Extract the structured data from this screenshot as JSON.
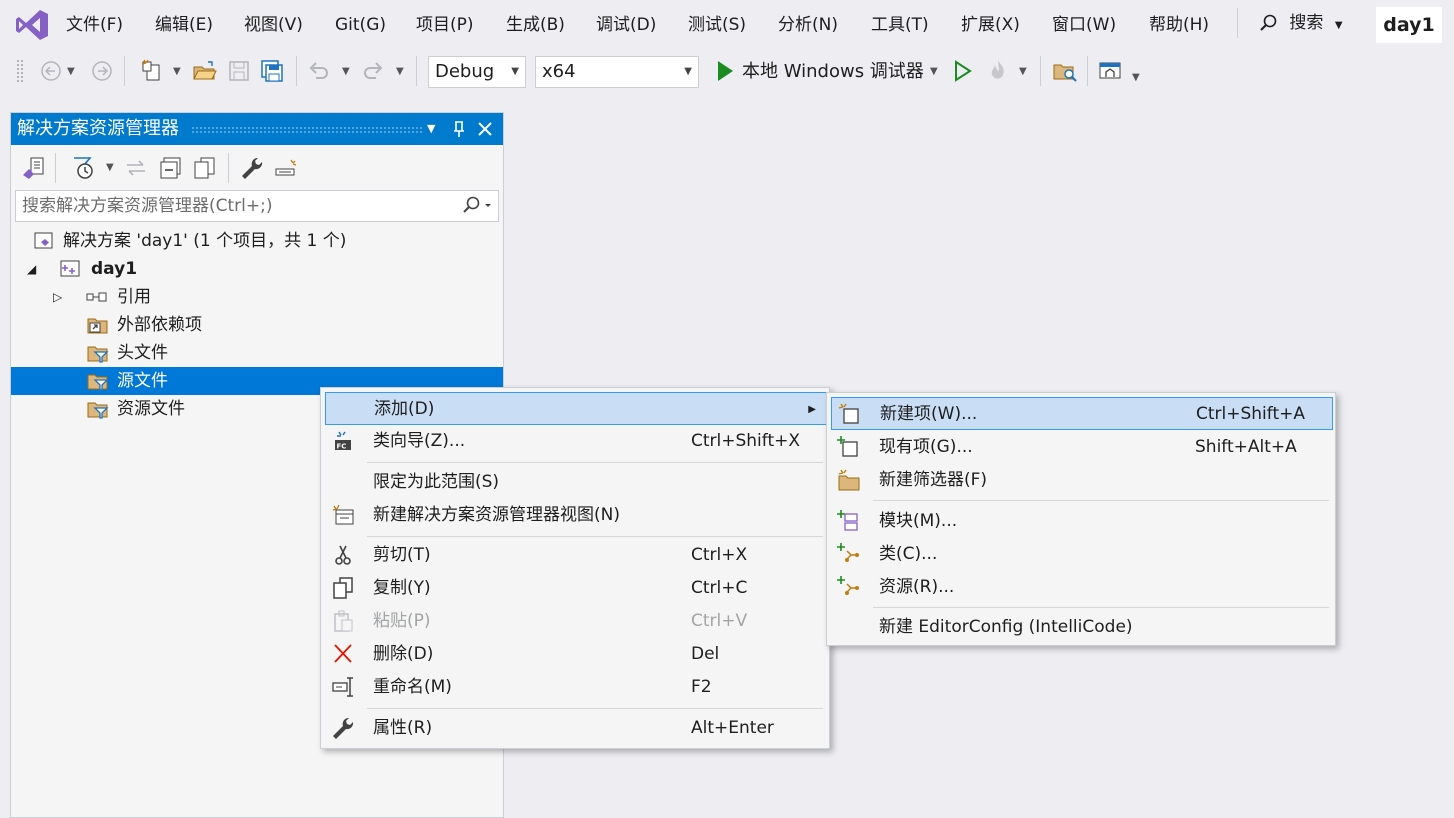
{
  "menubar": {
    "items": [
      "文件(F)",
      "编辑(E)",
      "视图(V)",
      "Git(G)",
      "项目(P)",
      "生成(B)",
      "调试(D)",
      "测试(S)",
      "分析(N)",
      "工具(T)",
      "扩展(X)",
      "窗口(W)",
      "帮助(H)"
    ],
    "search_label": "搜索",
    "solution_name": "day1"
  },
  "toolbar": {
    "config_value": "Debug",
    "platform_value": "x64",
    "run_label": "本地 Windows 调试器"
  },
  "solution_explorer": {
    "title": "解决方案资源管理器",
    "search_placeholder": "搜索解决方案资源管理器(Ctrl+;)",
    "tree": [
      {
        "label": "解决方案 'day1' (1 个项目，共 1 个)"
      },
      {
        "label": "day1"
      },
      {
        "label": "引用"
      },
      {
        "label": "外部依赖项"
      },
      {
        "label": "头文件"
      },
      {
        "label": "源文件"
      },
      {
        "label": "资源文件"
      }
    ]
  },
  "context_menu": {
    "items": [
      {
        "label": "添加(D)",
        "key": ""
      },
      {
        "label": "类向导(Z)...",
        "key": "Ctrl+Shift+X"
      },
      {
        "label": "限定为此范围(S)",
        "key": ""
      },
      {
        "label": "新建解决方案资源管理器视图(N)",
        "key": ""
      },
      {
        "label": "剪切(T)",
        "key": "Ctrl+X"
      },
      {
        "label": "复制(Y)",
        "key": "Ctrl+C"
      },
      {
        "label": "粘贴(P)",
        "key": "Ctrl+V"
      },
      {
        "label": "删除(D)",
        "key": "Del"
      },
      {
        "label": "重命名(M)",
        "key": "F2"
      },
      {
        "label": "属性(R)",
        "key": "Alt+Enter"
      }
    ]
  },
  "submenu": {
    "items": [
      {
        "label": "新建项(W)...",
        "key": "Ctrl+Shift+A"
      },
      {
        "label": "现有项(G)...",
        "key": "Shift+Alt+A"
      },
      {
        "label": "新建筛选器(F)",
        "key": ""
      },
      {
        "label": "模块(M)...",
        "key": ""
      },
      {
        "label": "类(C)...",
        "key": ""
      },
      {
        "label": "资源(R)...",
        "key": ""
      },
      {
        "label": "新建 EditorConfig (IntelliCode)",
        "key": ""
      }
    ]
  },
  "colors": {
    "accent": "#007acc",
    "selection": "#0078d7",
    "menu_highlight": "#c9def5",
    "vs_purple": "#68217a"
  }
}
